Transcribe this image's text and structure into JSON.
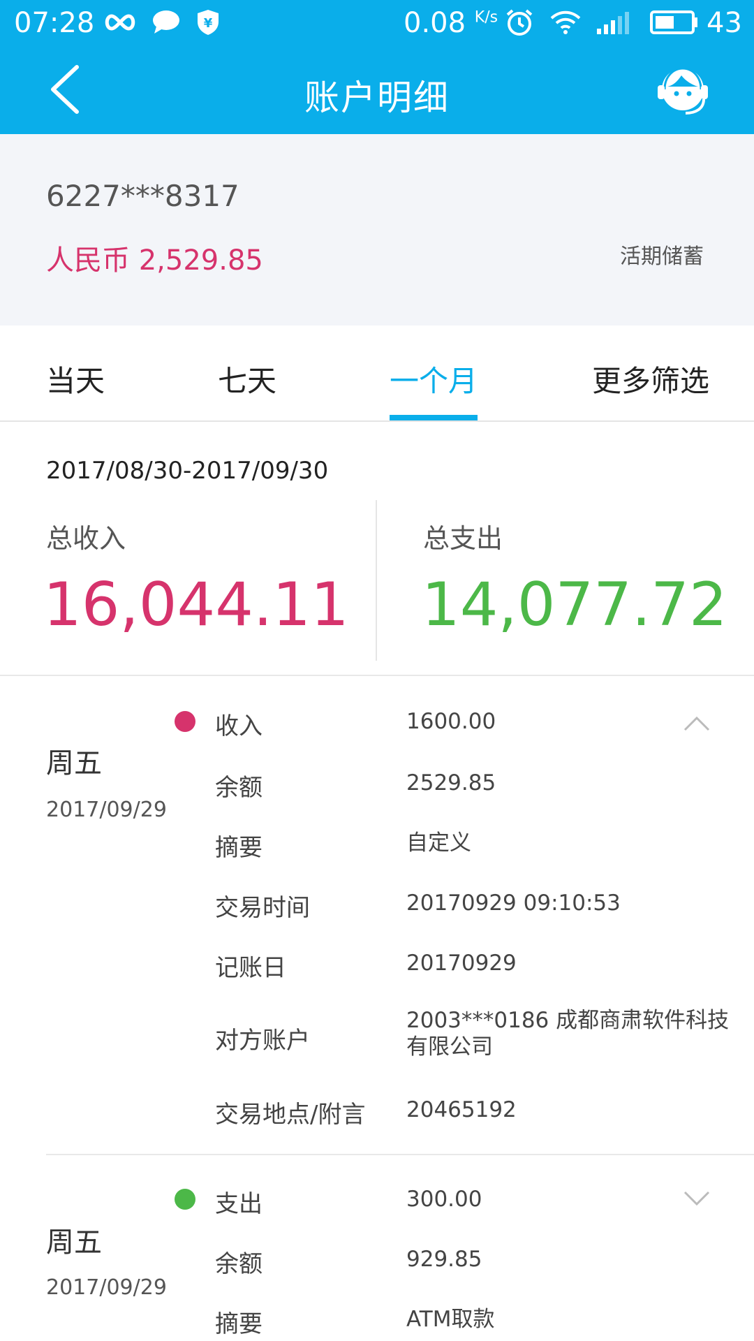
{
  "status_bar": {
    "time": "07:28",
    "net_speed": "0.08",
    "net_unit": "K/s",
    "battery": "43"
  },
  "header": {
    "title": "账户明细"
  },
  "account": {
    "number": "6227***8317",
    "balance": "人民币 2,529.85",
    "type": "活期储蓄"
  },
  "tabs": [
    {
      "label": "当天"
    },
    {
      "label": "七天"
    },
    {
      "label": "一个月",
      "active": true
    },
    {
      "label": "更多筛选"
    }
  ],
  "summary": {
    "date_range": "2017/08/30-2017/09/30",
    "income_label": "总收入",
    "income_value": "16,044.11",
    "expense_label": "总支出",
    "expense_value": "14,077.72"
  },
  "colors": {
    "brand": "#0aaeea",
    "income": "#d6336c",
    "expense": "#4cb848"
  },
  "transactions": [
    {
      "weekday": "周五",
      "date": "2017/09/29",
      "expanded": true,
      "rows": [
        {
          "label": "收入",
          "value": "1600.00"
        },
        {
          "label": "余额",
          "value": "2529.85"
        },
        {
          "label": "摘要",
          "value": "自定义"
        },
        {
          "label": "交易时间",
          "value": "20170929 09:10:53"
        },
        {
          "label": "记账日",
          "value": "20170929"
        },
        {
          "label": "对方账户",
          "value": "2003***0186 成都商肃软件科技有限公司"
        },
        {
          "label": "交易地点/附言",
          "value": "20465192"
        }
      ]
    },
    {
      "weekday": "周五",
      "date": "2017/09/29",
      "expanded": false,
      "rows": [
        {
          "label": "支出",
          "value": "300.00"
        },
        {
          "label": "余额",
          "value": "929.85"
        },
        {
          "label": "摘要",
          "value": "ATM取款"
        }
      ]
    }
  ]
}
